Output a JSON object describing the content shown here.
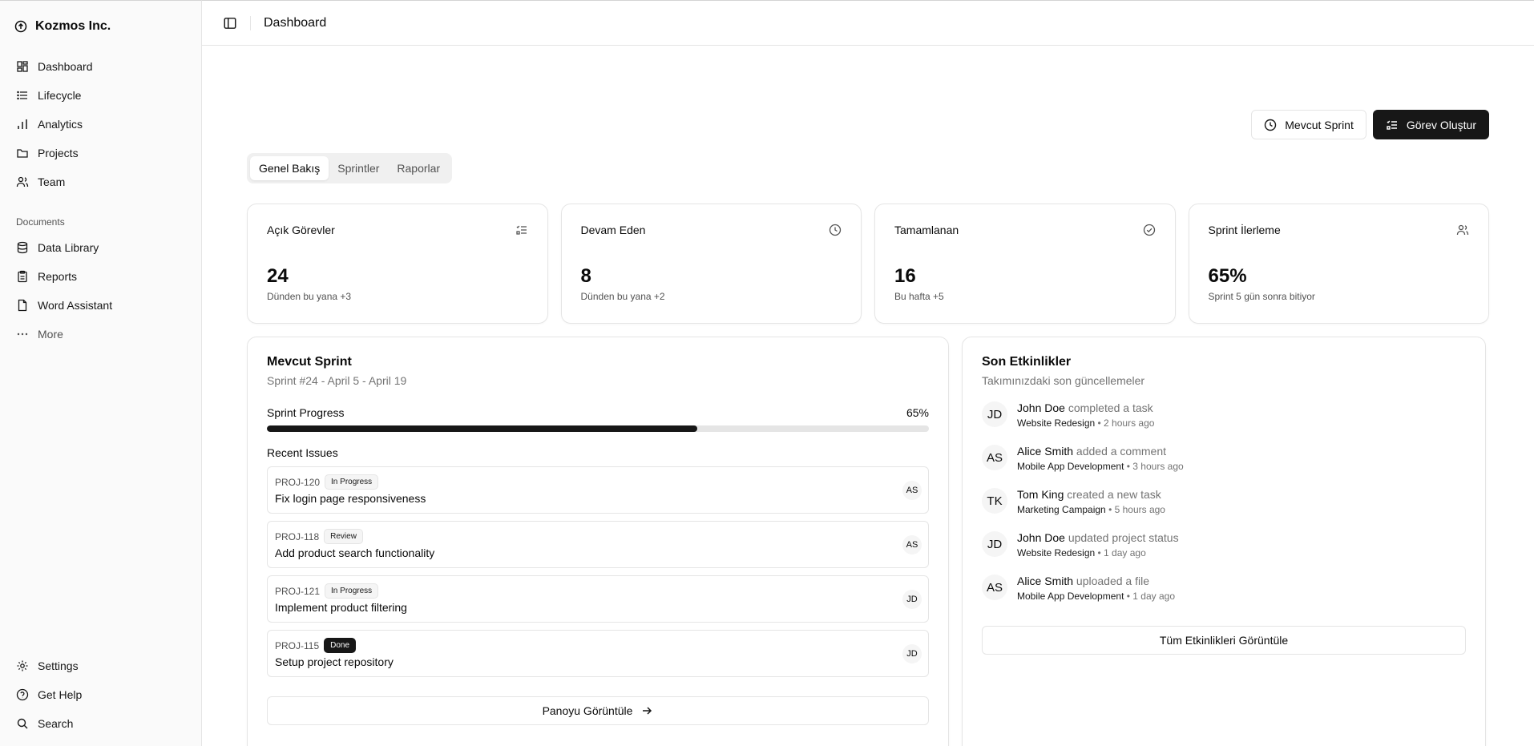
{
  "sidebar": {
    "brand": "Kozmos Inc.",
    "nav": [
      {
        "label": "Dashboard",
        "icon": "dashboard-icon"
      },
      {
        "label": "Lifecycle",
        "icon": "list-icon"
      },
      {
        "label": "Analytics",
        "icon": "bar-chart-icon"
      },
      {
        "label": "Projects",
        "icon": "folder-icon"
      },
      {
        "label": "Team",
        "icon": "users-icon"
      }
    ],
    "documents_label": "Documents",
    "documents": [
      {
        "label": "Data Library",
        "icon": "database-icon"
      },
      {
        "label": "Reports",
        "icon": "clipboard-icon"
      },
      {
        "label": "Word Assistant",
        "icon": "file-icon"
      }
    ],
    "more_label": "More",
    "bottom": [
      {
        "label": "Settings",
        "icon": "gear-icon"
      },
      {
        "label": "Get Help",
        "icon": "help-icon"
      },
      {
        "label": "Search",
        "icon": "search-icon"
      }
    ]
  },
  "header": {
    "title": "Dashboard"
  },
  "actions": {
    "current_sprint": "Mevcut Sprint",
    "create_task": "Görev Oluştur"
  },
  "tabs": [
    "Genel Bakış",
    "Sprintler",
    "Raporlar"
  ],
  "stats": [
    {
      "title": "Açık Görevler",
      "value": "24",
      "sub": "Dünden bu yana +3",
      "icon": "list-check-icon"
    },
    {
      "title": "Devam Eden",
      "value": "8",
      "sub": "Dünden bu yana +2",
      "icon": "clock-icon"
    },
    {
      "title": "Tamamlanan",
      "value": "16",
      "sub": "Bu hafta +5",
      "icon": "check-circle-icon"
    },
    {
      "title": "Sprint İlerleme",
      "value": "65%",
      "sub": "Sprint 5 gün sonra bitiyor",
      "icon": "users-icon"
    }
  ],
  "sprint": {
    "title": "Mevcut Sprint",
    "subtitle": "Sprint #24 - April 5 - April 19",
    "progress_label": "Sprint Progress",
    "progress_text": "65%",
    "progress": 0.65,
    "recent_label": "Recent Issues",
    "issues": [
      {
        "id": "PROJ-120",
        "status": "In Progress",
        "title": "Fix login page responsiveness",
        "assignee": "AS"
      },
      {
        "id": "PROJ-118",
        "status": "Review",
        "title": "Add product search functionality",
        "assignee": "AS"
      },
      {
        "id": "PROJ-121",
        "status": "In Progress",
        "title": "Implement product filtering",
        "assignee": "JD"
      },
      {
        "id": "PROJ-115",
        "status": "Done",
        "title": "Setup project repository",
        "assignee": "JD"
      }
    ],
    "board_button": "Panoyu Görüntüle"
  },
  "activity": {
    "title": "Son Etkinlikler",
    "subtitle": "Takımınızdaki son güncellemeler",
    "items": [
      {
        "initials": "JD",
        "name": "John Doe",
        "action": "completed a task",
        "project": "Website Redesign",
        "time": "• 2 hours ago"
      },
      {
        "initials": "AS",
        "name": "Alice Smith",
        "action": "added a comment",
        "project": "Mobile App Development",
        "time": "• 3 hours ago"
      },
      {
        "initials": "TK",
        "name": "Tom King",
        "action": "created a new task",
        "project": "Marketing Campaign",
        "time": "• 5 hours ago"
      },
      {
        "initials": "JD",
        "name": "John Doe",
        "action": "updated project status",
        "project": "Website Redesign",
        "time": "• 1 day ago"
      },
      {
        "initials": "AS",
        "name": "Alice Smith",
        "action": "uploaded a file",
        "project": "Mobile App Development",
        "time": "• 1 day ago"
      }
    ],
    "all_button": "Tüm Etkinlikleri Görüntüle"
  }
}
